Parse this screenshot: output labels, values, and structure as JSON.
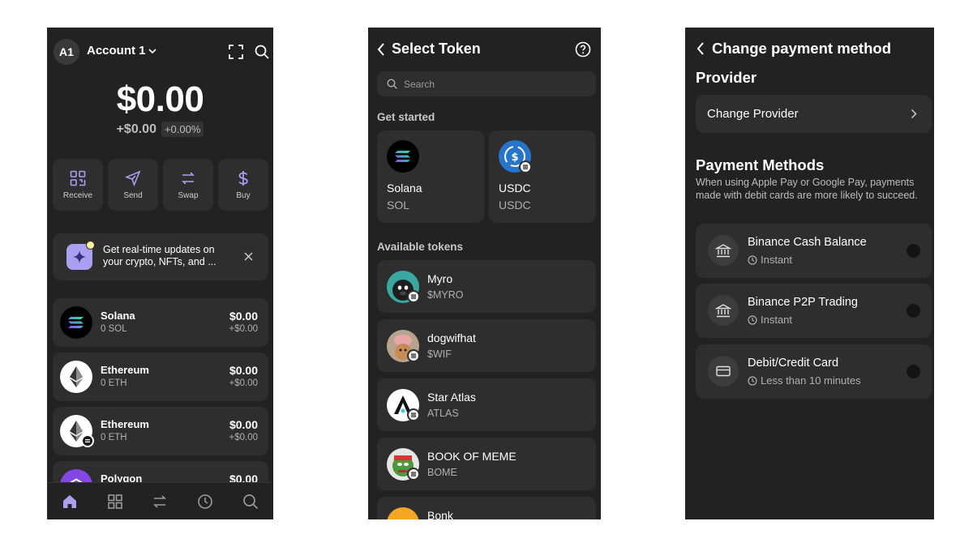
{
  "wallet": {
    "avatar_initials": "A1",
    "account_name": "Account 1",
    "balance": "$0.00",
    "balance_change": "+$0.00",
    "balance_change_pct": "+0.00%",
    "actions": [
      {
        "label": "Receive",
        "icon": "qr-code-icon"
      },
      {
        "label": "Send",
        "icon": "send-icon"
      },
      {
        "label": "Swap",
        "icon": "swap-icon"
      },
      {
        "label": "Buy",
        "icon": "dollar-icon"
      }
    ],
    "banner_text": "Get real-time updates on your crypto, NFTs, and ...",
    "assets": [
      {
        "name": "Solana",
        "amount": "0 SOL",
        "value": "$0.00",
        "change": "+$0.00",
        "icon": "solana-logo"
      },
      {
        "name": "Ethereum",
        "amount": "0 ETH",
        "value": "$0.00",
        "change": "+$0.00",
        "icon": "ethereum-logo"
      },
      {
        "name": "Ethereum",
        "amount": "0 ETH",
        "value": "$0.00",
        "change": "+$0.00",
        "icon": "ethereum-logo"
      },
      {
        "name": "Polygon",
        "amount": "",
        "value": "$0.00",
        "change": "",
        "icon": "polygon-logo"
      }
    ],
    "nav": [
      "home-icon",
      "grid-icon",
      "swap-icon",
      "history-icon",
      "search-icon"
    ],
    "colors": {
      "accent": "#ab9ff2",
      "bg": "#222222",
      "card": "#2e2e2e"
    }
  },
  "select_token": {
    "title": "Select Token",
    "search_placeholder": "Search",
    "get_started_label": "Get started",
    "featured": [
      {
        "name": "Solana",
        "symbol": "SOL"
      },
      {
        "name": "USDC",
        "symbol": "USDC"
      }
    ],
    "available_label": "Available tokens",
    "tokens": [
      {
        "name": "Myro",
        "symbol": "$MYRO"
      },
      {
        "name": "dogwifhat",
        "symbol": "$WIF"
      },
      {
        "name": "Star Atlas",
        "symbol": "ATLAS"
      },
      {
        "name": "BOOK OF MEME",
        "symbol": "BOME"
      },
      {
        "name": "Bonk",
        "symbol": ""
      }
    ]
  },
  "payment": {
    "title": "Change payment method",
    "provider_heading": "Provider",
    "change_provider": "Change Provider",
    "methods_heading": "Payment Methods",
    "methods_desc": "When using Apple Pay or Google Pay, payments made with debit cards are more likely to succeed.",
    "methods": [
      {
        "name": "Binance Cash Balance",
        "eta": "Instant",
        "icon": "bank-icon"
      },
      {
        "name": "Binance P2P Trading",
        "eta": "Instant",
        "icon": "bank-icon"
      },
      {
        "name": "Debit/Credit Card",
        "eta": "Less than 10 minutes",
        "icon": "credit-card-icon"
      }
    ]
  }
}
